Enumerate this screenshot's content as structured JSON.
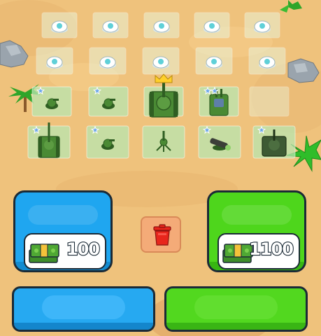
{
  "palette": {
    "sand": "#efc27c",
    "sand_dark": "#e4b06a",
    "tile_locked": "#e9f2d6",
    "tile_active": "#b9e6b0",
    "tank_green": "#4a8a34",
    "panel_blue": "#1fa6f0",
    "panel_green": "#4ed61c",
    "trash_red": "#e8261c",
    "outline": "#1b2a36"
  },
  "board": {
    "locked_slot_icon": "lock-disc-icon",
    "empty_tile_icon": "empty-tile",
    "units": [
      {
        "name": "small-turret",
        "stars": 1,
        "crown": false
      },
      {
        "name": "small-turret",
        "stars": 1,
        "crown": false
      },
      {
        "name": "heavy-tank",
        "stars": 0,
        "crown": true
      },
      {
        "name": "twin-tank",
        "stars": 2,
        "crown": false
      },
      {
        "name": "long-barrel-tank",
        "stars": 1,
        "crown": false
      },
      {
        "name": "small-turret",
        "stars": 1,
        "crown": false
      },
      {
        "name": "tripod-gun",
        "stars": 0,
        "crown": false
      },
      {
        "name": "rocket-launcher",
        "stars": 1,
        "crown": false
      },
      {
        "name": "dark-tank",
        "stars": 1,
        "crown": false
      }
    ]
  },
  "shop": {
    "left": {
      "price": "100",
      "icon": "cash-stack-icon"
    },
    "right": {
      "price": "1100",
      "icon": "cash-stack-icon"
    },
    "trash_icon": "trash-icon"
  },
  "buttons": {
    "left_color": "blue",
    "right_color": "green"
  }
}
